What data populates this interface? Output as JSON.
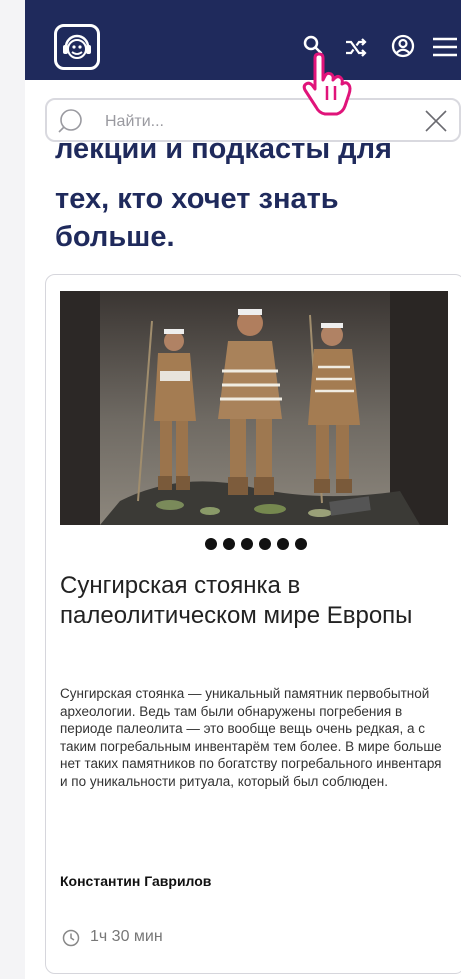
{
  "header": {
    "logo": "monkey-headphones-logo",
    "icons": [
      "search-icon",
      "shuffle-icon",
      "account-icon",
      "menu-icon"
    ]
  },
  "search": {
    "placeholder": "Найти...",
    "value": ""
  },
  "headline": {
    "line_cut": "лекции и подкасты для",
    "line2": "тех, кто хочет знать",
    "line3": "больше."
  },
  "card": {
    "image": "museum-diorama-three-figures",
    "carousel_dots": 6,
    "title": "Сунгирская стоянка в палеолитическом мире Европы",
    "description": "Сунгирская стоянка — уникальный памятник первобытной археологии. Ведь там были обнаружены погребения в периоде палеолита — это вообще вещь очень редкая, а с таким погребальным инвентарём тем более. В мире больше нет таких памятников по богатству погребального инвентаря и по уникальности ритуала, который был соблюден.",
    "author": "Константин Гаврилов",
    "duration": "1ч 30 мин"
  },
  "colors": {
    "header_bg": "#1f2a5c",
    "accent_pink": "#e0147a",
    "headline": "#1f2a5c"
  }
}
